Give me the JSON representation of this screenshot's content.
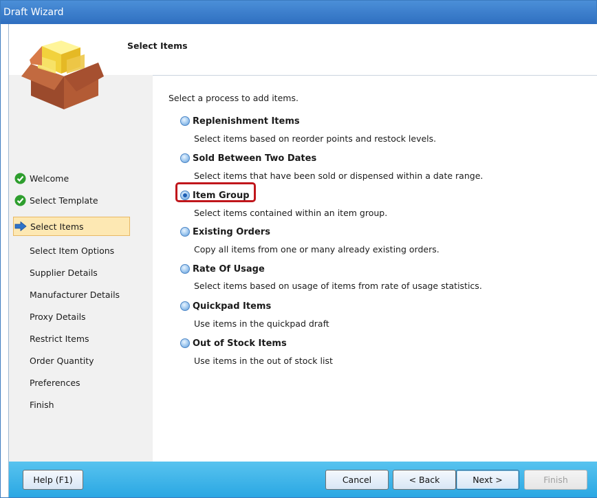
{
  "window": {
    "title": "Draft Wizard"
  },
  "header": {
    "title": "Select Items",
    "icon": "package-box-icon"
  },
  "sidebar": {
    "items": [
      {
        "label": "Welcome",
        "state": "done"
      },
      {
        "label": "Select Template",
        "state": "done"
      },
      {
        "label": "Select Items",
        "state": "current"
      },
      {
        "label": "Select Item Options",
        "state": "pending"
      },
      {
        "label": "Supplier Details",
        "state": "pending"
      },
      {
        "label": "Manufacturer Details",
        "state": "pending"
      },
      {
        "label": "Proxy Details",
        "state": "pending"
      },
      {
        "label": "Restrict Items",
        "state": "pending"
      },
      {
        "label": "Order Quantity",
        "state": "pending"
      },
      {
        "label": "Preferences",
        "state": "pending"
      },
      {
        "label": "Finish",
        "state": "pending"
      }
    ]
  },
  "main": {
    "prompt": "Select a process to add items.",
    "selected_option": "Item Group",
    "options": [
      {
        "label": "Replenishment Items",
        "description": "Select items based on reorder points and restock levels."
      },
      {
        "label": "Sold Between Two Dates",
        "description": "Select items that have been sold or dispensed within a date range."
      },
      {
        "label": "Item Group",
        "description": "Select items contained within an item group."
      },
      {
        "label": "Existing Orders",
        "description": "Copy all items from one or many already existing orders."
      },
      {
        "label": "Rate Of Usage",
        "description": "Select items based on usage of items from rate of usage statistics."
      },
      {
        "label": "Quickpad Items",
        "description": "Use items in the quickpad draft"
      },
      {
        "label": "Out of Stock Items",
        "description": "Use items in the out of stock list"
      }
    ]
  },
  "footer": {
    "help": "Help (F1)",
    "cancel": "Cancel",
    "back": "< Back",
    "next": "Next >",
    "finish": "Finish"
  },
  "colors": {
    "highlight": "#c0161b",
    "footer": "#2aa7e3",
    "titlebar": "#2f6fc0"
  }
}
